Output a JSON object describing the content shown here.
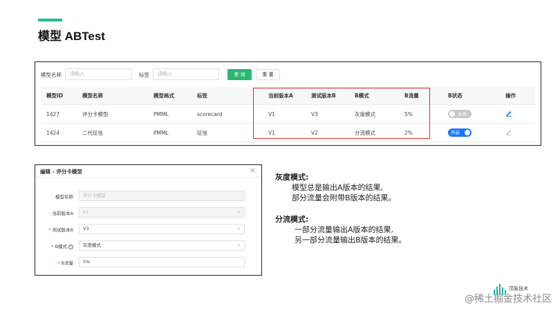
{
  "page": {
    "title": "模型 ABTest"
  },
  "search": {
    "name_label": "模型名称",
    "name_placeholder": "请输入",
    "tag_label": "标签",
    "tag_placeholder": "请输入",
    "query_label": "查 询",
    "reset_label": "重 置"
  },
  "table": {
    "headers": [
      "模型ID",
      "模型名称",
      "模型格式",
      "标签",
      "当前版本A",
      "测试版本B",
      "B模式",
      "B流量",
      "B状态",
      "操作"
    ],
    "rows": [
      {
        "id": "1427",
        "name": "评分卡模型",
        "format": "PMML",
        "tag": "scorecard",
        "version_a": "V1",
        "version_b": "V3",
        "b_mode": "灰度模式",
        "b_traffic": "5%",
        "b_status": "关闭",
        "b_status_on": false,
        "action_icon": "edit-icon"
      },
      {
        "id": "1424",
        "name": "二代征信",
        "format": "PMML",
        "tag": "征信",
        "version_a": "V1",
        "version_b": "V2",
        "b_mode": "分流模式",
        "b_traffic": "2%",
        "b_status": "开启",
        "b_status_on": true,
        "action_icon": "edit-icon-disabled"
      }
    ]
  },
  "dialog": {
    "title": "编辑 - 评分卡模型",
    "close_icon": "close-icon",
    "fields": {
      "model_name": {
        "label": "模型名称",
        "value": "评分卡模型",
        "disabled": true
      },
      "current_version_a": {
        "label": "当前版本A",
        "value": "V1",
        "disabled": true
      },
      "test_version_b": {
        "label": "测试版本B",
        "value": "V3",
        "required": true
      },
      "b_mode": {
        "label": "B模式",
        "value": "灰度模式",
        "required": true
      },
      "b_traffic": {
        "label": "B流量",
        "value": "5%",
        "required": true
      }
    },
    "info_icon": "info-icon"
  },
  "explanation": {
    "gray": {
      "heading": "灰度模式:",
      "lines": [
        "模型总是输出A版本的结果,",
        "部分流量会附带B版本的结果。"
      ]
    },
    "split": {
      "heading": "分流模式:",
      "lines": [
        "一部分流量输出A版本的结果,",
        "另一部分流量输出B版本的结果。"
      ]
    }
  },
  "watermark": {
    "logo_text": "顶象技术",
    "text": "@稀土掘金技术社区"
  },
  "colors": {
    "accent": "#1abc9c",
    "primary_button": "#2bb673",
    "toggle_on": "#1677ff",
    "highlight_border": "#d9262c",
    "link": "#1677ff"
  }
}
